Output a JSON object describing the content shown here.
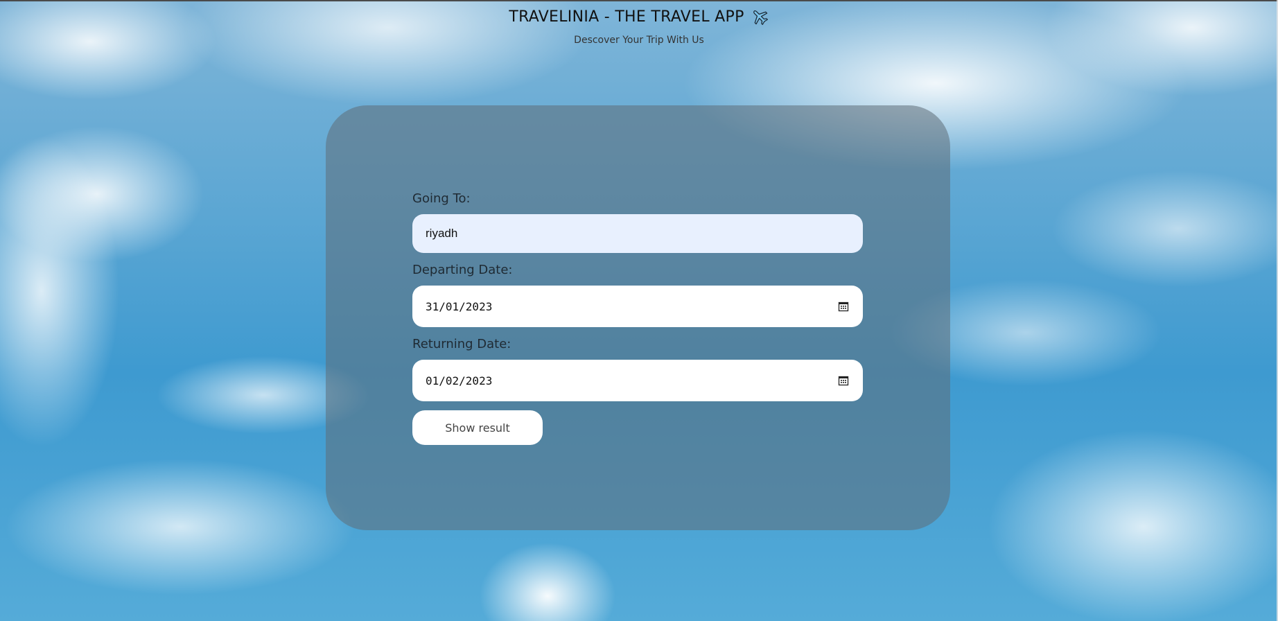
{
  "header": {
    "title": "TRAVELINIA - THE TRAVEL APP",
    "title_icon": "airplane-icon",
    "subtitle": "Descover Your Trip With Us"
  },
  "form": {
    "destination": {
      "label": "Going To:",
      "value": "riyadh"
    },
    "departing": {
      "label": "Departing Date:",
      "value": "31/01/2023",
      "icon": "calendar-icon"
    },
    "returning": {
      "label": "Returning Date:",
      "value": "01/02/2023",
      "icon": "calendar-icon"
    },
    "submit_label": "Show result"
  },
  "colors": {
    "card_overlay": "#5f6e78",
    "input_autofill": "#e8f0fe",
    "input_bg": "#ffffff",
    "title_text": "#111111"
  }
}
